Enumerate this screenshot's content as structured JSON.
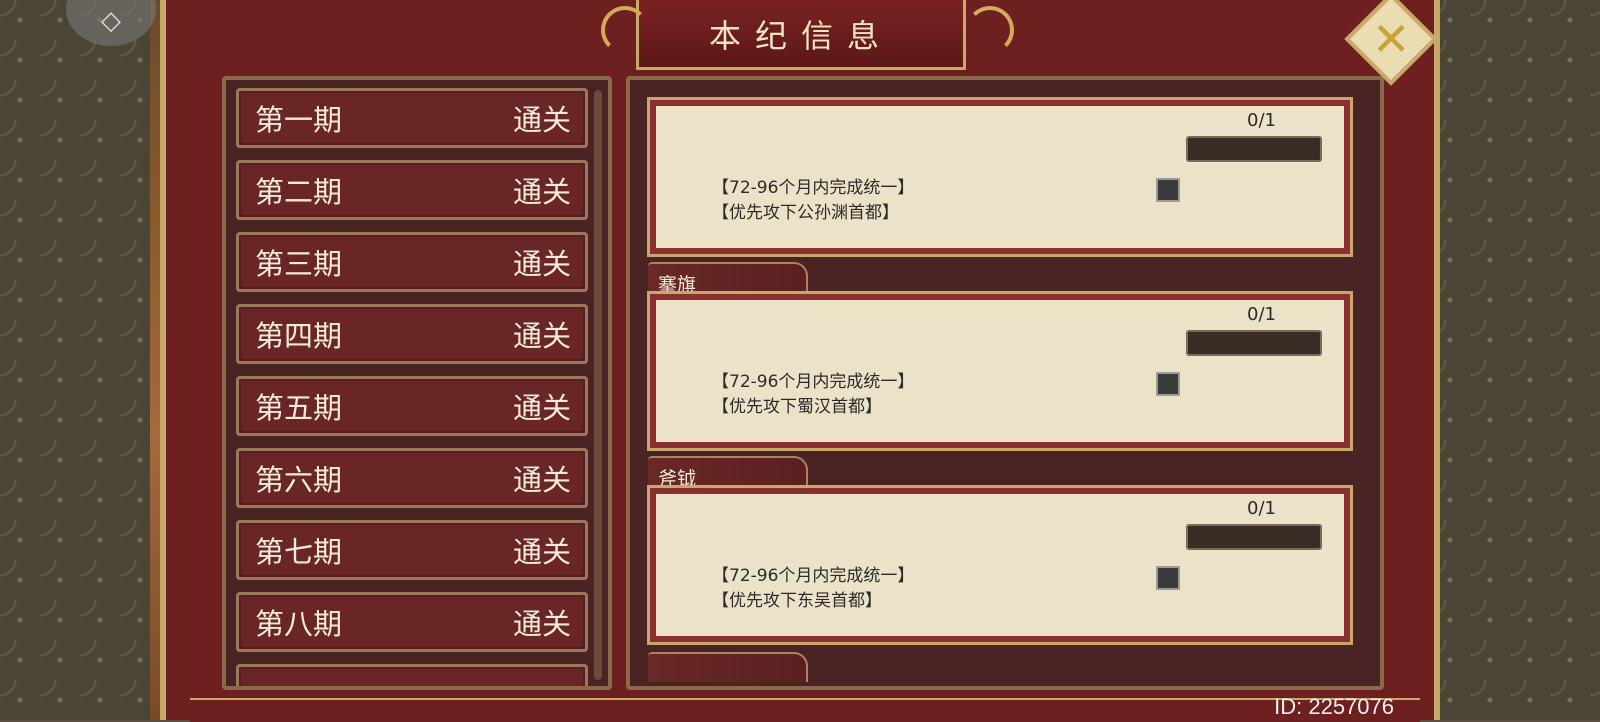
{
  "header": {
    "title": "本纪信息",
    "close_icon": "close-x-icon",
    "top_left_icon": "gem-icon"
  },
  "left_list": {
    "items": [
      {
        "period": "第一期",
        "status": "通关"
      },
      {
        "period": "第二期",
        "status": "通关"
      },
      {
        "period": "第三期",
        "status": "通关"
      },
      {
        "period": "第四期",
        "status": "通关"
      },
      {
        "period": "第五期",
        "status": "通关"
      },
      {
        "period": "第六期",
        "status": "通关"
      },
      {
        "period": "第七期",
        "status": "通关"
      },
      {
        "period": "第八期",
        "status": "通关"
      }
    ]
  },
  "right_panel": {
    "cards": [
      {
        "tab": "",
        "progress": "0/1",
        "line1": "【72-96个月内完成统一】",
        "line2": "【优先攻下公孙渊首都】"
      },
      {
        "tab": "搴旗",
        "progress": "0/1",
        "line1": "【72-96个月内完成统一】",
        "line2": "【优先攻下蜀汉首都】"
      },
      {
        "tab": "斧钺",
        "progress": "0/1",
        "line1": "【72-96个月内完成统一】",
        "line2": "【优先攻下东吴首都】"
      }
    ]
  },
  "footer": {
    "id_text": "ID: 2257076"
  },
  "colors": {
    "frame_red": "#6e1f1f",
    "gold_trim": "#c9a96a",
    "parchment": "#ece2c8"
  }
}
